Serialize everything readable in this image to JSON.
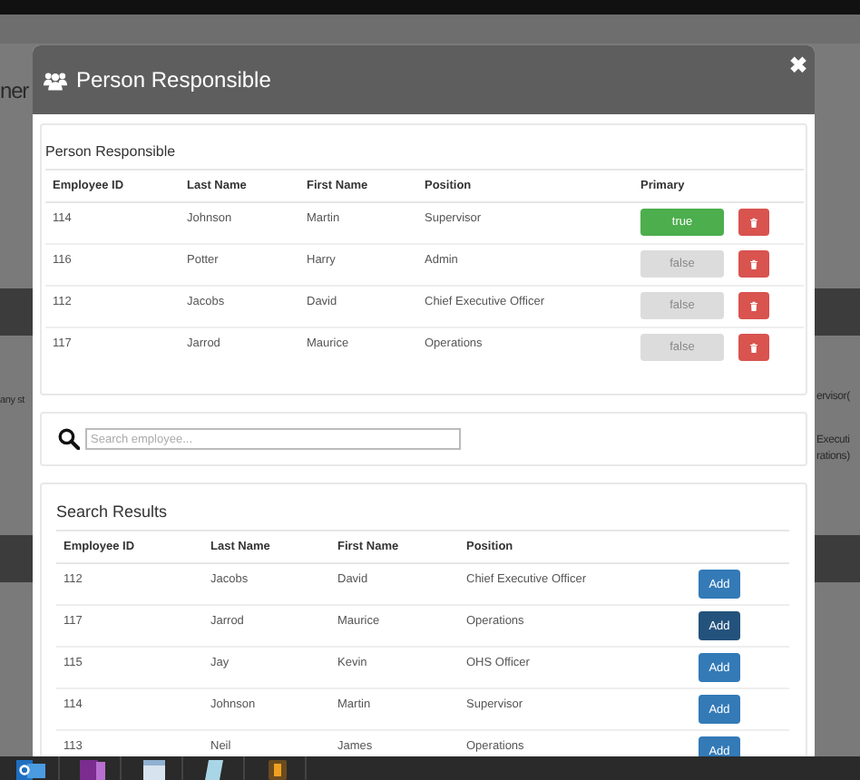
{
  "background": {
    "heading_fragment": "ner",
    "left_fragment": "any st",
    "right_fragments": [
      "ervisor(",
      "Executi",
      "rations)"
    ]
  },
  "modal": {
    "title": "Person Responsible",
    "close": "✖"
  },
  "responsible": {
    "title": "Person Responsible",
    "columns": [
      "Employee ID",
      "Last Name",
      "First Name",
      "Position",
      "Primary"
    ],
    "rows": [
      {
        "id": "114",
        "last": "Johnson",
        "first": "Martin",
        "position": "Supervisor",
        "primary": true,
        "primary_label": "true"
      },
      {
        "id": "116",
        "last": "Potter",
        "first": "Harry",
        "position": "Admin",
        "primary": false,
        "primary_label": "false"
      },
      {
        "id": "112",
        "last": "Jacobs",
        "first": "David",
        "position": "Chief Executive Officer",
        "primary": false,
        "primary_label": "false"
      },
      {
        "id": "117",
        "last": "Jarrod",
        "first": "Maurice",
        "position": "Operations",
        "primary": false,
        "primary_label": "false"
      }
    ]
  },
  "search": {
    "placeholder": "Search employee..."
  },
  "results": {
    "title": "Search Results",
    "columns": [
      "Employee ID",
      "Last Name",
      "First Name",
      "Position"
    ],
    "rows": [
      {
        "id": "112",
        "last": "Jacobs",
        "first": "David",
        "position": "Chief Executive Officer",
        "button": "Add",
        "focused": false
      },
      {
        "id": "117",
        "last": "Jarrod",
        "first": "Maurice",
        "position": "Operations",
        "button": "Add",
        "focused": true
      },
      {
        "id": "115",
        "last": "Jay",
        "first": "Kevin",
        "position": "OHS Officer",
        "button": "Add",
        "focused": false
      },
      {
        "id": "114",
        "last": "Johnson",
        "first": "Martin",
        "position": "Supervisor",
        "button": "Add",
        "focused": false
      },
      {
        "id": "113",
        "last": "Neil",
        "first": "James",
        "position": "Operations",
        "button": "Add",
        "focused": false
      }
    ]
  },
  "taskbar": {
    "apps": [
      {
        "kind": "mail"
      },
      {
        "kind": "notebook"
      },
      {
        "kind": "window"
      },
      {
        "kind": "document"
      },
      {
        "kind": "app"
      }
    ]
  }
}
